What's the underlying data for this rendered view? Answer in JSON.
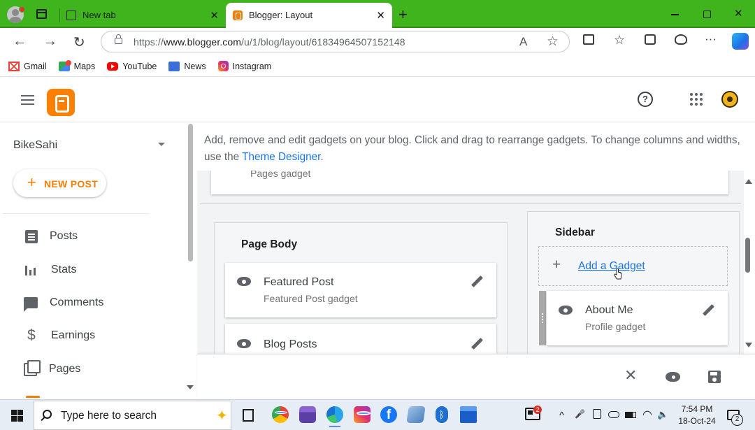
{
  "browser": {
    "tabs": [
      {
        "title": "New tab",
        "active": false
      },
      {
        "title": "Blogger: Layout",
        "active": true
      }
    ],
    "close_glyph": "✕",
    "new_tab_glyph": "+",
    "window_close_glyph": "✕",
    "url_prefix": "https://",
    "url_domain": "www.blogger.com",
    "url_path": "/u/1/blog/layout/61834964507152148",
    "read_aloud_glyph": "A",
    "favorite_glyph": "☆",
    "more_glyph": "···",
    "back_glyph": "←",
    "forward_glyph": "→",
    "reload_glyph": "↻"
  },
  "bookmarks": [
    {
      "label": "Gmail",
      "icon": "gmail-icon"
    },
    {
      "label": "Maps",
      "icon": "maps-icon"
    },
    {
      "label": "YouTube",
      "icon": "youtube-icon"
    },
    {
      "label": "News",
      "icon": "news-icon"
    },
    {
      "label": "Instagram",
      "icon": "instagram-icon"
    }
  ],
  "blogger": {
    "help_glyph": "?",
    "blog_name": "BikeSahi",
    "new_post": {
      "plus": "+",
      "label": "NEW POST"
    },
    "nav": [
      {
        "label": "Posts",
        "icon": "posts-icon"
      },
      {
        "label": "Stats",
        "icon": "stats-icon"
      },
      {
        "label": "Comments",
        "icon": "comments-icon"
      },
      {
        "label": "Earnings",
        "icon": "earnings-icon"
      },
      {
        "label": "Pages",
        "icon": "pages-icon"
      }
    ],
    "earnings_glyph": "$"
  },
  "layout": {
    "intro_text": "Add, remove and edit gadgets on your blog. Click and drag to rearrange gadgets. To change columns and widths, use the ",
    "intro_link": "Theme Designer",
    "intro_end": ".",
    "pages_gadget_sub": "Pages gadget",
    "page_body": {
      "title": "Page Body",
      "gadgets": [
        {
          "title": "Featured Post",
          "subtitle": "Featured Post gadget"
        },
        {
          "title": "Blog Posts",
          "subtitle": ""
        }
      ]
    },
    "sidebar": {
      "title": "Sidebar",
      "add_plus": "+",
      "add_label": "Add a Gadget",
      "gadgets": [
        {
          "title": "About Me",
          "subtitle": "Profile gadget"
        }
      ]
    }
  },
  "actions": {
    "close_glyph": "✕"
  },
  "taskbar": {
    "search_placeholder": "Type here to search",
    "sparkle_glyph": "✦",
    "facebook_glyph": "f",
    "bluetooth_glyph": "ᛒ",
    "news_badge": "2",
    "tray_chevron": "^",
    "tray_mic": "🎤",
    "tray_wifi": "◠",
    "tray_volume": "🔈",
    "time": "7:54 PM",
    "date": "18-Oct-24",
    "notification_count": "2"
  }
}
